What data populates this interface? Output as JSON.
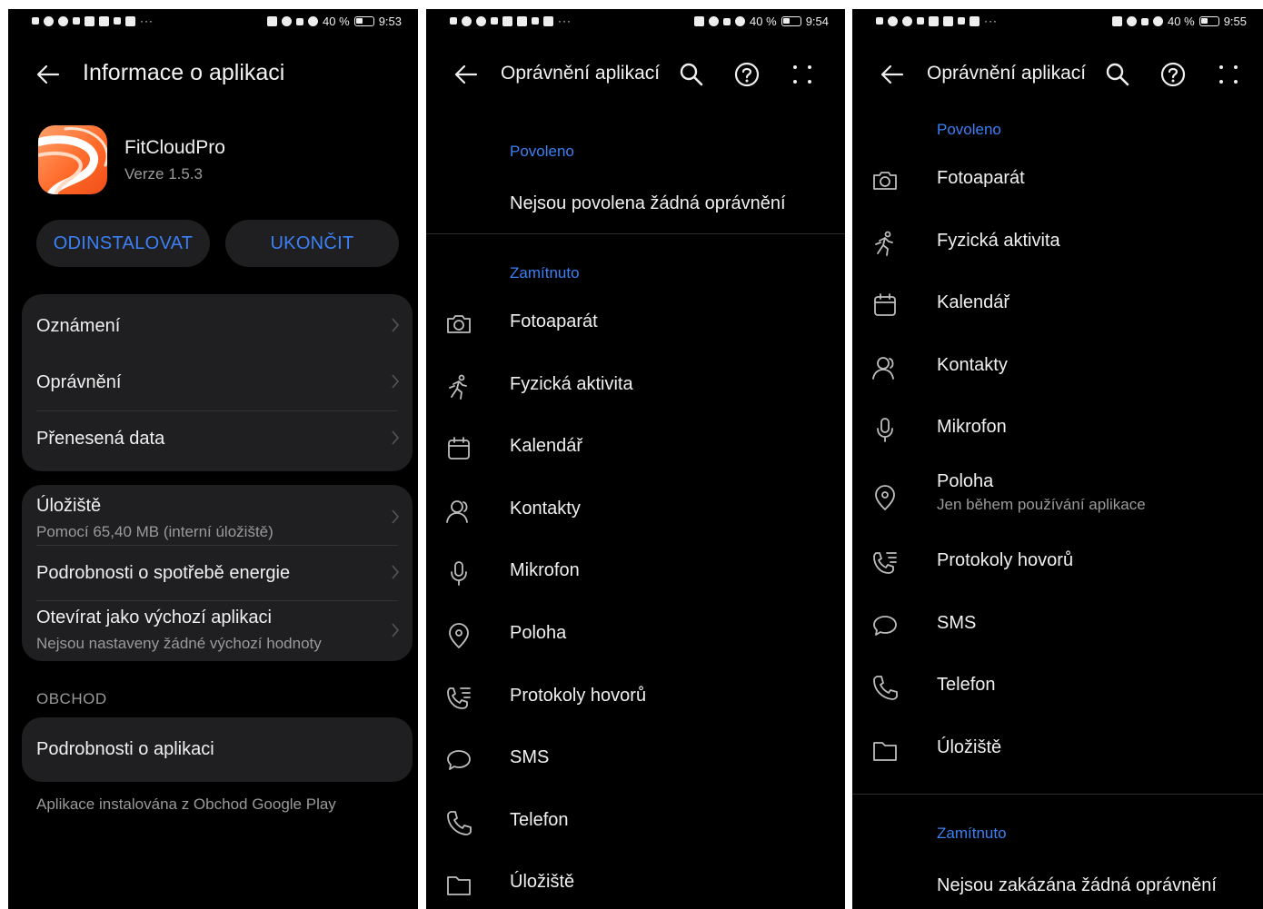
{
  "colors": {
    "background": "#000000",
    "card": "#1f1f21",
    "accent": "#3b80f5",
    "text_primary": "#f0f0f0",
    "text_secondary": "#9a9a9a"
  },
  "screen1": {
    "status": {
      "battery": "40 %",
      "time": "9:53"
    },
    "title": "Informace o aplikaci",
    "app": {
      "name": "FitCloudPro",
      "version": "Verze 1.5.3",
      "icon": "fitcloudpro-app-icon"
    },
    "buttons": {
      "uninstall": "ODINSTALOVAT",
      "stop": "UKONČIT"
    },
    "group1": [
      {
        "label": "Oznámení"
      },
      {
        "label": "Oprávnění"
      },
      {
        "label": "Přenesená data"
      }
    ],
    "storage": {
      "label": "Úložiště",
      "sub": "Pomocí 65,40 MB (interní úložiště)"
    },
    "energy": {
      "label": "Podrobnosti o spotřebě energie"
    },
    "default_app": {
      "label": "Otevírat jako výchozí aplikaci",
      "sub": "Nejsou nastaveny žádné výchozí hodnoty"
    },
    "store_section": "OBCHOD",
    "app_details": "Podrobnosti o aplikaci",
    "footnote": "Aplikace instalována z Obchod Google Play"
  },
  "screen2": {
    "status": {
      "battery": "40 %",
      "time": "9:54"
    },
    "title": "Oprávnění aplikací",
    "allowed_header": "Povoleno",
    "allowed_empty": "Nejsou povolena žádná oprávnění",
    "denied_header": "Zamítnuto",
    "denied": [
      {
        "label": "Fotoaparát",
        "icon": "camera-icon"
      },
      {
        "label": "Fyzická aktivita",
        "icon": "activity-icon"
      },
      {
        "label": "Kalendář",
        "icon": "calendar-icon"
      },
      {
        "label": "Kontakty",
        "icon": "contacts-icon"
      },
      {
        "label": "Mikrofon",
        "icon": "microphone-icon"
      },
      {
        "label": "Poloha",
        "icon": "location-icon"
      },
      {
        "label": "Protokoly hovorů",
        "icon": "call-log-icon"
      },
      {
        "label": "SMS",
        "icon": "sms-icon"
      },
      {
        "label": "Telefon",
        "icon": "phone-icon"
      },
      {
        "label": "Úložiště",
        "icon": "storage-icon"
      }
    ]
  },
  "screen3": {
    "status": {
      "battery": "40 %",
      "time": "9:55"
    },
    "title": "Oprávnění aplikací",
    "allowed_header": "Povoleno",
    "allowed": [
      {
        "label": "Fotoaparát",
        "icon": "camera-icon"
      },
      {
        "label": "Fyzická aktivita",
        "icon": "activity-icon"
      },
      {
        "label": "Kalendář",
        "icon": "calendar-icon"
      },
      {
        "label": "Kontakty",
        "icon": "contacts-icon"
      },
      {
        "label": "Mikrofon",
        "icon": "microphone-icon"
      },
      {
        "label": "Poloha",
        "sub": "Jen během používání aplikace",
        "icon": "location-icon"
      },
      {
        "label": "Protokoly hovorů",
        "icon": "call-log-icon"
      },
      {
        "label": "SMS",
        "icon": "sms-icon"
      },
      {
        "label": "Telefon",
        "icon": "phone-icon"
      },
      {
        "label": "Úložiště",
        "icon": "storage-icon"
      }
    ],
    "denied_header": "Zamítnuto",
    "denied_empty": "Nejsou zakázána žádná oprávnění"
  }
}
